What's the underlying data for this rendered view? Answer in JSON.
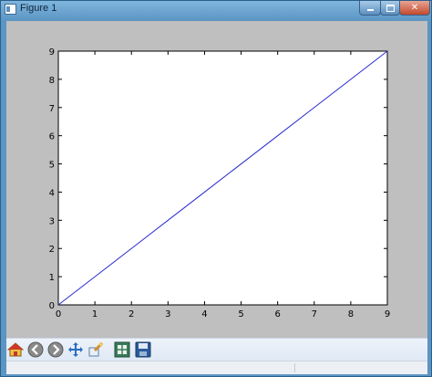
{
  "window": {
    "title": "Figure 1",
    "controls": {
      "minimize": "minimize",
      "maximize": "maximize",
      "close": "✕"
    }
  },
  "toolbar": {
    "buttons": [
      {
        "name": "home-button",
        "icon": "home-icon"
      },
      {
        "name": "back-button",
        "icon": "arrow-left-icon"
      },
      {
        "name": "forward-button",
        "icon": "arrow-right-icon"
      },
      {
        "name": "pan-button",
        "icon": "move-icon"
      },
      {
        "name": "zoom-button",
        "icon": "zoom-rect-icon"
      },
      {
        "name": "subplots-button",
        "icon": "subplots-icon"
      },
      {
        "name": "save-button",
        "icon": "floppy-icon"
      }
    ]
  },
  "chart_data": {
    "type": "line",
    "title": "",
    "xlabel": "",
    "ylabel": "",
    "xlim": [
      0,
      9
    ],
    "ylim": [
      0,
      9
    ],
    "xticks": [
      "0",
      "1",
      "2",
      "3",
      "4",
      "5",
      "6",
      "7",
      "8",
      "9"
    ],
    "yticks": [
      "0",
      "1",
      "2",
      "3",
      "4",
      "5",
      "6",
      "7",
      "8",
      "9"
    ],
    "grid": false,
    "series": [
      {
        "color": "#2a2ad0",
        "x": [
          0,
          1,
          2,
          3,
          4,
          5,
          6,
          7,
          8,
          9
        ],
        "y": [
          0,
          1,
          2,
          3,
          4,
          5,
          6,
          7,
          8,
          9
        ]
      }
    ]
  },
  "colors": {
    "figure_background": "#bfbfbf",
    "axes_background": "#ffffff",
    "line": "#2a2ad0"
  }
}
